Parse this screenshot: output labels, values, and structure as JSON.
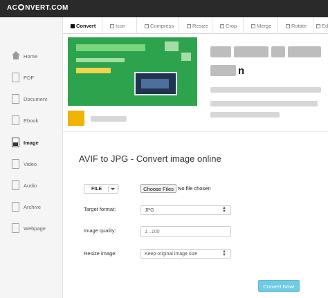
{
  "brand": {
    "logo_prefix": "AC",
    "logo_suffix": "NVERT.COM"
  },
  "sidebar": {
    "items": [
      {
        "label": "Home",
        "icon": "home-icon"
      },
      {
        "label": "PDF",
        "icon": "pdf-file-icon"
      },
      {
        "label": "Document",
        "icon": "document-file-icon"
      },
      {
        "label": "Ebook",
        "icon": "ebook-file-icon"
      },
      {
        "label": "Image",
        "icon": "image-file-icon",
        "active": true
      },
      {
        "label": "Video",
        "icon": "video-file-icon"
      },
      {
        "label": "Audio",
        "icon": "audio-file-icon"
      },
      {
        "label": "Archive",
        "icon": "archive-file-icon"
      },
      {
        "label": "Webpage",
        "icon": "webpage-file-icon"
      }
    ]
  },
  "tabs": [
    {
      "label": "Convert",
      "active": true
    },
    {
      "label": "Icon"
    },
    {
      "label": "Compress"
    },
    {
      "label": "Resize"
    },
    {
      "label": "Crop"
    },
    {
      "label": "Merge"
    },
    {
      "label": "Rotate"
    },
    {
      "label": "Ed"
    }
  ],
  "ad": {
    "visible_letter": "n"
  },
  "main": {
    "title": "AVIF to JPG - Convert image online",
    "file_button_label": "FILE",
    "choose_files_label": "Choose Files",
    "no_file_text": "No file chosen",
    "target_format_label": "Target format:",
    "target_format_value": "JPG",
    "quality_label": "Image quality:",
    "quality_placeholder": "1...100",
    "resize_label": "Resize image:",
    "resize_value": "Keep original image size",
    "convert_button_label": "Convert Now!"
  },
  "colors": {
    "topbar": "#2a2a2a",
    "sidebar_bg": "#f5f5f5",
    "convert_button": "#6fcbe3",
    "ad_green": "#2ea34d"
  }
}
